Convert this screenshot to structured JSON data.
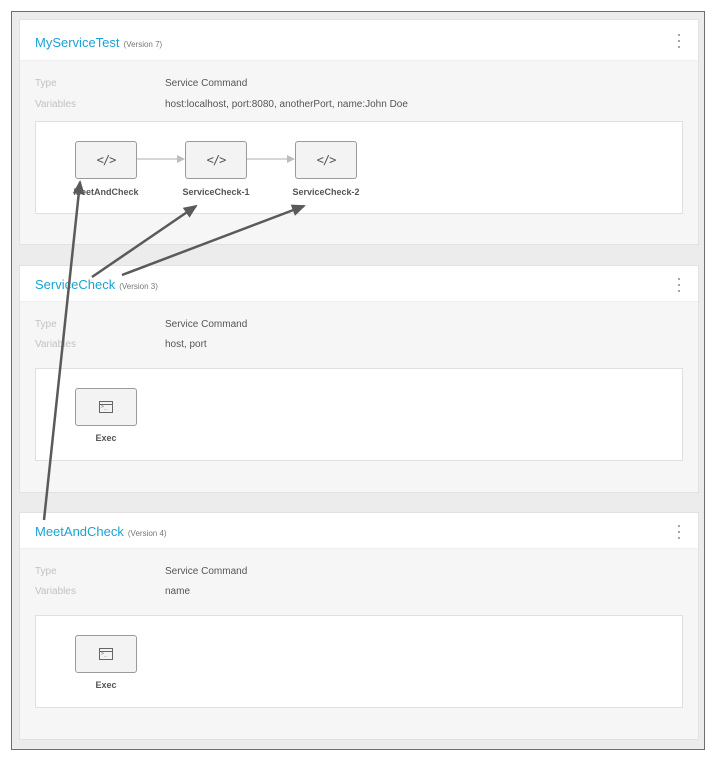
{
  "colors": {
    "title_link": "#1aa3d4",
    "annotation_arrow": "#5a5a5a",
    "connector": "#bdbdbd"
  },
  "cards": [
    {
      "title": "MyServiceTest",
      "version": "(Version 7)",
      "menu_icon": "kebab-menu-icon",
      "type_label": "Type",
      "type_value": "Service Command",
      "variables_label": "Variables",
      "variables_value": "host:localhost, port:8080, anotherPort, name:John Doe",
      "steps": [
        {
          "label": "MeetAndCheck",
          "icon": "code-icon",
          "icon_text": "</>"
        },
        {
          "label": "ServiceCheck-1",
          "icon": "code-icon",
          "icon_text": "</>"
        },
        {
          "label": "ServiceCheck-2",
          "icon": "code-icon",
          "icon_text": "</>"
        }
      ]
    },
    {
      "title": "ServiceCheck",
      "version": "(Version 3)",
      "menu_icon": "kebab-menu-icon",
      "type_label": "Type",
      "type_value": "Service Command",
      "variables_label": "Variables",
      "variables_value": "host, port",
      "steps": [
        {
          "label": "Exec",
          "icon": "terminal-icon"
        }
      ]
    },
    {
      "title": "MeetAndCheck",
      "version": "(Version 4)",
      "menu_icon": "kebab-menu-icon",
      "type_label": "Type",
      "type_value": "Service Command",
      "variables_label": "Variables",
      "variables_value": "name",
      "steps": [
        {
          "label": "Exec",
          "icon": "terminal-icon"
        }
      ]
    }
  ]
}
